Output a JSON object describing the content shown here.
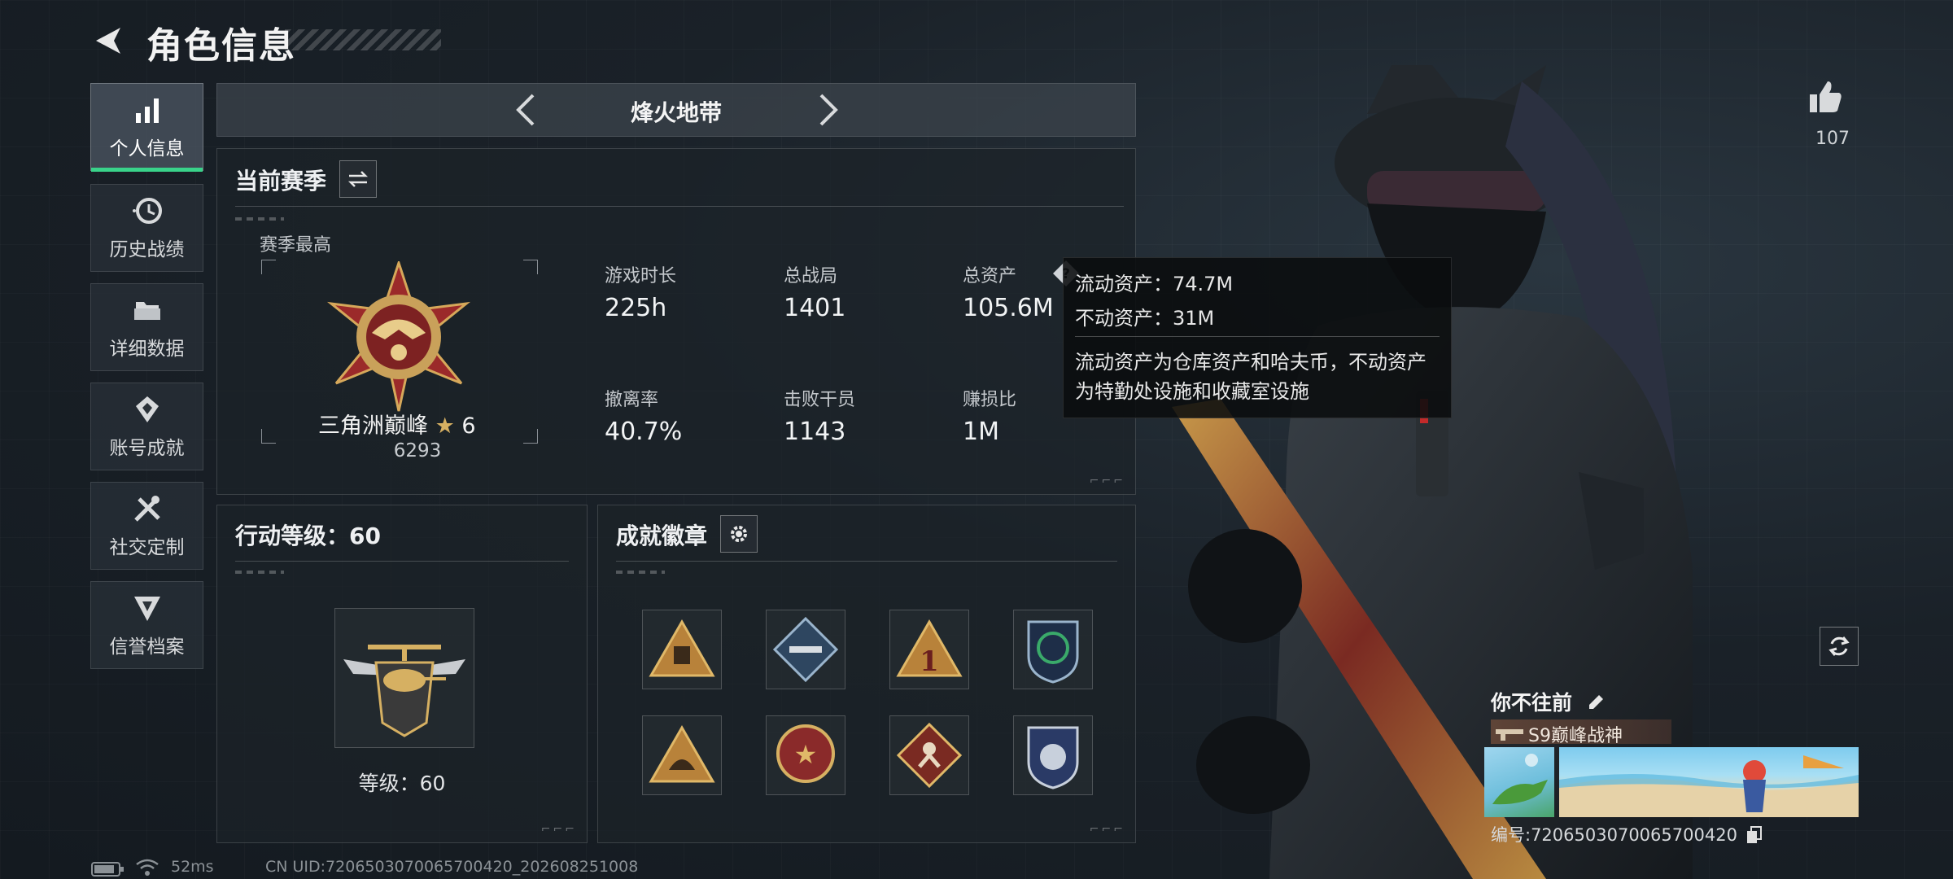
{
  "header": {
    "title": "角色信息"
  },
  "sidebar": {
    "items": [
      {
        "label": "个人信息",
        "icon": "stats-bars-icon",
        "active": true
      },
      {
        "label": "历史战绩",
        "icon": "history-clock-icon",
        "active": false
      },
      {
        "label": "详细数据",
        "icon": "folder-icon",
        "active": false
      },
      {
        "label": "账号成就",
        "icon": "achievement-icon",
        "active": false
      },
      {
        "label": "社交定制",
        "icon": "tools-icon",
        "active": false
      },
      {
        "label": "信誉档案",
        "icon": "reputation-shield-icon",
        "active": false
      }
    ]
  },
  "mode": {
    "title": "烽火地带"
  },
  "season": {
    "title": "当前赛季",
    "best_label": "赛季最高",
    "rank_name": "三角洲巅峰",
    "rank_stars": "6",
    "rank_score": "6293",
    "stats": [
      {
        "label": "游戏时长",
        "value": "225h"
      },
      {
        "label": "总战局",
        "value": "1401"
      },
      {
        "label": "总资产",
        "value": "105.6M"
      },
      {
        "label": "撤离率",
        "value": "40.7%"
      },
      {
        "label": "击败干员",
        "value": "1143"
      },
      {
        "label": "赚损比",
        "value": "1M"
      }
    ]
  },
  "tooltip": {
    "liquid": "流动资产：74.7M",
    "fixed": "不动资产：31M",
    "desc_line1": "流动资产为仓库资产和哈夫币，不动资产",
    "desc_line2": "为特勤处设施和收藏室设施"
  },
  "action_level": {
    "title": "行动等级：60",
    "level_text": "等级：60"
  },
  "badges": {
    "title": "成就徽章",
    "items": [
      "badge-triangle-bag",
      "badge-diamond-rocket",
      "badge-triangle-one",
      "badge-shield-green",
      "badge-triangle-helmet",
      "badge-round-star",
      "badge-diamond-runner",
      "badge-shield-blue"
    ]
  },
  "profile": {
    "likes": "107",
    "name": "你不往前",
    "title_tag": "S9巅峰战神",
    "id_text": "编号:7206503070065700420"
  },
  "status_bar": {
    "ping": "52ms",
    "uid": "CN UID:7206503070065700420_202608251008"
  },
  "colors": {
    "accent_green": "#39d38a",
    "panel_bg": "#1c2228"
  }
}
